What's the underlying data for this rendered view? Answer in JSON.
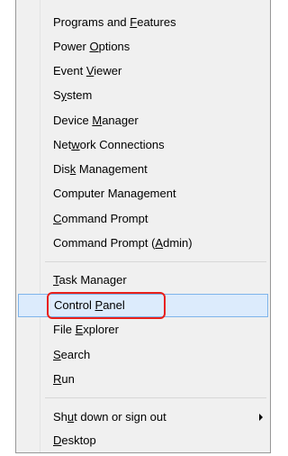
{
  "menu": {
    "items": [
      {
        "pre": "Programs and ",
        "acc": "F",
        "post": "eatures"
      },
      {
        "pre": "Power ",
        "acc": "O",
        "post": "ptions"
      },
      {
        "pre": "Event ",
        "acc": "V",
        "post": "iewer"
      },
      {
        "pre": "S",
        "acc": "y",
        "post": "stem"
      },
      {
        "pre": "Device ",
        "acc": "M",
        "post": "anager"
      },
      {
        "pre": "Net",
        "acc": "w",
        "post": "ork Connections"
      },
      {
        "pre": "Dis",
        "acc": "k",
        "post": " Management"
      },
      {
        "pre": "Computer Mana",
        "acc": "g",
        "post": "ement"
      },
      {
        "pre": "",
        "acc": "C",
        "post": "ommand Prompt"
      },
      {
        "pre": "Command Prompt (",
        "acc": "A",
        "post": "dmin)"
      },
      {
        "pre": "",
        "acc": "T",
        "post": "ask Manager"
      },
      {
        "pre": "Control ",
        "acc": "P",
        "post": "anel"
      },
      {
        "pre": "File ",
        "acc": "E",
        "post": "xplorer"
      },
      {
        "pre": "",
        "acc": "S",
        "post": "earch"
      },
      {
        "pre": "",
        "acc": "R",
        "post": "un"
      },
      {
        "pre": "Sh",
        "acc": "u",
        "post": "t down or sign out"
      },
      {
        "pre": "",
        "acc": "D",
        "post": "esktop"
      }
    ]
  },
  "colors": {
    "hover_bg": "#dcebfc",
    "hover_border": "#7eb4ea",
    "annotation": "#e8201a"
  }
}
